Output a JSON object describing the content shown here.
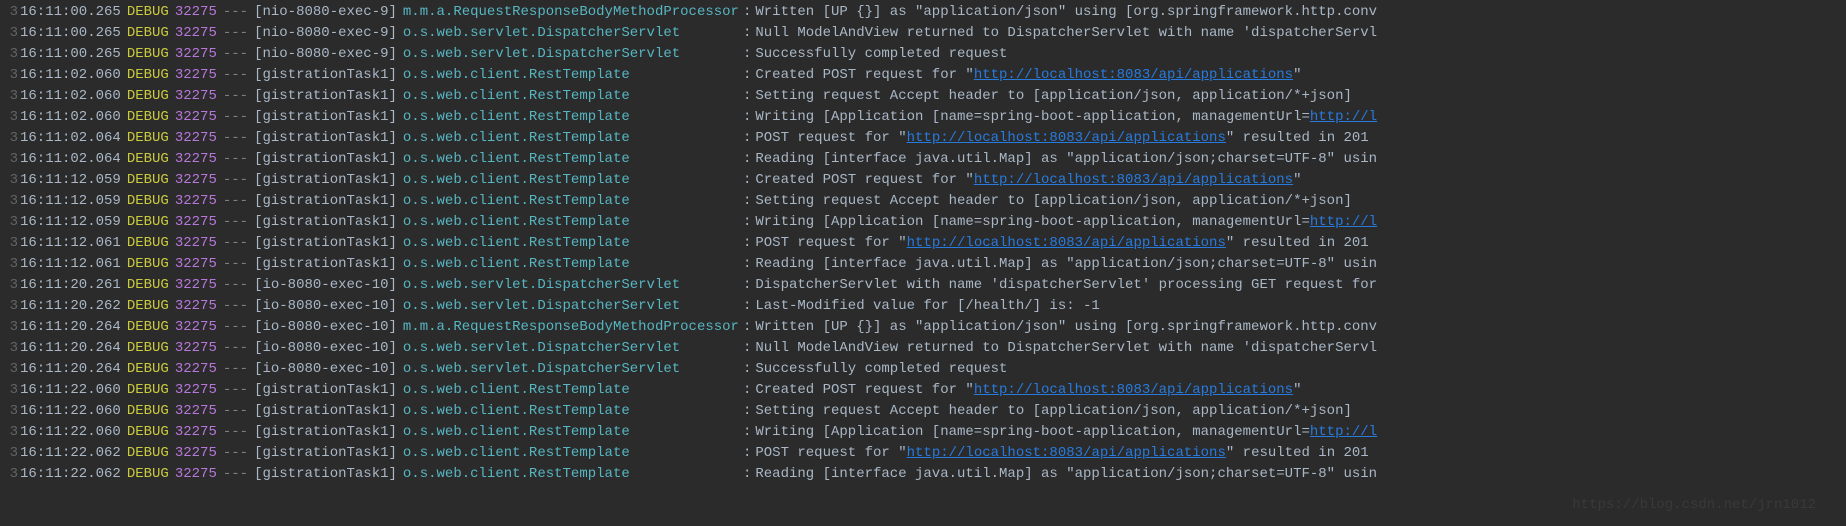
{
  "watermark": "https://blog.csdn.net/jrn1012",
  "url": "http://localhost:8083/api/applications",
  "gutter": "3",
  "lines": [
    {
      "time": "16:11:00.265",
      "level": "DEBUG",
      "pid": "32275",
      "thread": "[nio-8080-exec-9]",
      "logger": "m.m.a.RequestResponseBodyMethodProcessor",
      "loggerClass": "logger-m",
      "msg": "Written [UP {}] as \"application/json\" using [org.springframework.http.conv"
    },
    {
      "time": "16:11:00.265",
      "level": "DEBUG",
      "pid": "32275",
      "thread": "[nio-8080-exec-9]",
      "logger": "o.s.web.servlet.DispatcherServlet",
      "loggerClass": "logger-o",
      "msg": "Null ModelAndView returned to DispatcherServlet with name 'dispatcherServl"
    },
    {
      "time": "16:11:00.265",
      "level": "DEBUG",
      "pid": "32275",
      "thread": "[nio-8080-exec-9]",
      "logger": "o.s.web.servlet.DispatcherServlet",
      "loggerClass": "logger-o",
      "msg": "Successfully completed request"
    },
    {
      "time": "16:11:02.060",
      "level": "DEBUG",
      "pid": "32275",
      "thread": "[gistrationTask1]",
      "logger": "o.s.web.client.RestTemplate",
      "loggerClass": "logger-o",
      "msg_pre": "Created POST request for \"",
      "msg_url": true,
      "msg_post": "\""
    },
    {
      "time": "16:11:02.060",
      "level": "DEBUG",
      "pid": "32275",
      "thread": "[gistrationTask1]",
      "logger": "o.s.web.client.RestTemplate",
      "loggerClass": "logger-o",
      "msg": "Setting request Accept header to [application/json, application/*+json]"
    },
    {
      "time": "16:11:02.060",
      "level": "DEBUG",
      "pid": "32275",
      "thread": "[gistrationTask1]",
      "logger": "o.s.web.client.RestTemplate",
      "loggerClass": "logger-o",
      "msg_pre": "Writing [Application [name=spring-boot-application, managementUrl=",
      "msg_url_partial": "http://l"
    },
    {
      "time": "16:11:02.064",
      "level": "DEBUG",
      "pid": "32275",
      "thread": "[gistrationTask1]",
      "logger": "o.s.web.client.RestTemplate",
      "loggerClass": "logger-o",
      "msg_pre": "POST request for \"",
      "msg_url": true,
      "msg_post": "\" resulted in 201"
    },
    {
      "time": "16:11:02.064",
      "level": "DEBUG",
      "pid": "32275",
      "thread": "[gistrationTask1]",
      "logger": "o.s.web.client.RestTemplate",
      "loggerClass": "logger-o",
      "msg": "Reading [interface java.util.Map] as \"application/json;charset=UTF-8\" usin"
    },
    {
      "time": "16:11:12.059",
      "level": "DEBUG",
      "pid": "32275",
      "thread": "[gistrationTask1]",
      "logger": "o.s.web.client.RestTemplate",
      "loggerClass": "logger-o",
      "msg_pre": "Created POST request for \"",
      "msg_url": true,
      "msg_post": "\""
    },
    {
      "time": "16:11:12.059",
      "level": "DEBUG",
      "pid": "32275",
      "thread": "[gistrationTask1]",
      "logger": "o.s.web.client.RestTemplate",
      "loggerClass": "logger-o",
      "msg": "Setting request Accept header to [application/json, application/*+json]"
    },
    {
      "time": "16:11:12.059",
      "level": "DEBUG",
      "pid": "32275",
      "thread": "[gistrationTask1]",
      "logger": "o.s.web.client.RestTemplate",
      "loggerClass": "logger-o",
      "msg_pre": "Writing [Application [name=spring-boot-application, managementUrl=",
      "msg_url_partial": "http://l"
    },
    {
      "time": "16:11:12.061",
      "level": "DEBUG",
      "pid": "32275",
      "thread": "[gistrationTask1]",
      "logger": "o.s.web.client.RestTemplate",
      "loggerClass": "logger-o",
      "msg_pre": "POST request for \"",
      "msg_url": true,
      "msg_post": "\" resulted in 201"
    },
    {
      "time": "16:11:12.061",
      "level": "DEBUG",
      "pid": "32275",
      "thread": "[gistrationTask1]",
      "logger": "o.s.web.client.RestTemplate",
      "loggerClass": "logger-o",
      "msg": "Reading [interface java.util.Map] as \"application/json;charset=UTF-8\" usin"
    },
    {
      "time": "16:11:20.261",
      "level": "DEBUG",
      "pid": "32275",
      "thread": "[io-8080-exec-10]",
      "logger": "o.s.web.servlet.DispatcherServlet",
      "loggerClass": "logger-o",
      "msg": "DispatcherServlet with name 'dispatcherServlet' processing GET request for"
    },
    {
      "time": "16:11:20.262",
      "level": "DEBUG",
      "pid": "32275",
      "thread": "[io-8080-exec-10]",
      "logger": "o.s.web.servlet.DispatcherServlet",
      "loggerClass": "logger-o",
      "msg": "Last-Modified value for [/health/] is: -1"
    },
    {
      "time": "16:11:20.264",
      "level": "DEBUG",
      "pid": "32275",
      "thread": "[io-8080-exec-10]",
      "logger": "m.m.a.RequestResponseBodyMethodProcessor",
      "loggerClass": "logger-m",
      "msg": "Written [UP {}] as \"application/json\" using [org.springframework.http.conv"
    },
    {
      "time": "16:11:20.264",
      "level": "DEBUG",
      "pid": "32275",
      "thread": "[io-8080-exec-10]",
      "logger": "o.s.web.servlet.DispatcherServlet",
      "loggerClass": "logger-o",
      "msg": "Null ModelAndView returned to DispatcherServlet with name 'dispatcherServl"
    },
    {
      "time": "16:11:20.264",
      "level": "DEBUG",
      "pid": "32275",
      "thread": "[io-8080-exec-10]",
      "logger": "o.s.web.servlet.DispatcherServlet",
      "loggerClass": "logger-o",
      "msg": "Successfully completed request"
    },
    {
      "time": "16:11:22.060",
      "level": "DEBUG",
      "pid": "32275",
      "thread": "[gistrationTask1]",
      "logger": "o.s.web.client.RestTemplate",
      "loggerClass": "logger-o",
      "msg_pre": "Created POST request for \"",
      "msg_url": true,
      "msg_post": "\""
    },
    {
      "time": "16:11:22.060",
      "level": "DEBUG",
      "pid": "32275",
      "thread": "[gistrationTask1]",
      "logger": "o.s.web.client.RestTemplate",
      "loggerClass": "logger-o",
      "msg": "Setting request Accept header to [application/json, application/*+json]"
    },
    {
      "time": "16:11:22.060",
      "level": "DEBUG",
      "pid": "32275",
      "thread": "[gistrationTask1]",
      "logger": "o.s.web.client.RestTemplate",
      "loggerClass": "logger-o",
      "msg_pre": "Writing [Application [name=spring-boot-application, managementUrl=",
      "msg_url_partial": "http://l"
    },
    {
      "time": "16:11:22.062",
      "level": "DEBUG",
      "pid": "32275",
      "thread": "[gistrationTask1]",
      "logger": "o.s.web.client.RestTemplate",
      "loggerClass": "logger-o",
      "msg_pre": "POST request for \"",
      "msg_url": true,
      "msg_post": "\" resulted in 201"
    },
    {
      "time": "16:11:22.062",
      "level": "DEBUG",
      "pid": "32275",
      "thread": "[gistrationTask1]",
      "logger": "o.s.web.client.RestTemplate",
      "loggerClass": "logger-o",
      "msg": "Reading [interface java.util.Map] as \"application/json;charset=UTF-8\" usin"
    }
  ]
}
